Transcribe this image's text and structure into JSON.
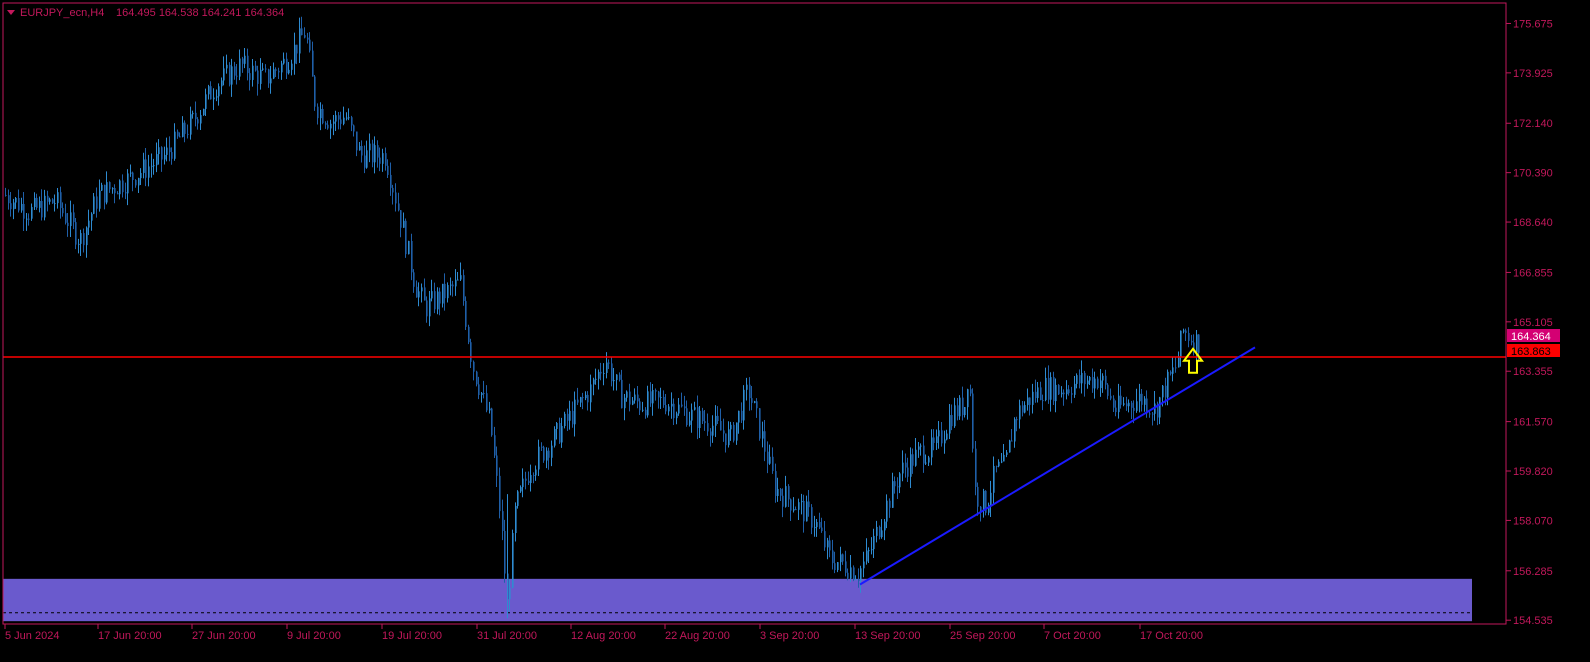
{
  "header": {
    "symbol": "EURJPY_ecn,H4",
    "ohlc": "164.495 164.538 164.241 164.364"
  },
  "colors": {
    "background": "#000000",
    "frame": "#c2185b",
    "text": "#c2185b",
    "candle": "#2e8bd1",
    "candle_dark": "#1f5fa8",
    "support_zone": "#6a5acd",
    "horizontal_line": "#ff0000",
    "trendline": "#1a1aff",
    "arrow": "#ffff00",
    "bid_tag": "#ff0000",
    "last_tag": "#d40073"
  },
  "chart_data": {
    "type": "candlestick",
    "title": "EURJPY_ecn,H4",
    "ylim": [
      154.4,
      176.4
    ],
    "y_ticks": [
      "175.675",
      "173.925",
      "172.140",
      "170.390",
      "168.640",
      "166.855",
      "165.105",
      "163.355",
      "161.570",
      "159.820",
      "158.070",
      "156.285",
      "154.535"
    ],
    "x_ticks": [
      "5 Jun 2024",
      "17 Jun 20:00",
      "27 Jun 20:00",
      "9 Jul 20:00",
      "19 Jul 20:00",
      "31 Jul 20:00",
      "12 Aug 20:00",
      "22 Aug 20:00",
      "3 Sep 20:00",
      "13 Sep 20:00",
      "25 Sep 20:00",
      "7 Oct 20:00",
      "17 Oct 20:00"
    ],
    "price_path_closes_by_tick": [
      {
        "x": "5 Jun 2024",
        "close": 169.8
      },
      {
        "x": "17 Jun 20:00",
        "close": 169.6
      },
      {
        "x": "27 Jun 20:00",
        "close": 173.8
      },
      {
        "x": "9 Jul 20:00",
        "close": 175.2
      },
      {
        "x": "19 Jul 20:00",
        "close": 170.0
      },
      {
        "x": "31 Jul 20:00",
        "close": 161.0
      },
      {
        "x": "12 Aug 20:00",
        "close": 162.5
      },
      {
        "x": "22 Aug 20:00",
        "close": 161.0
      },
      {
        "x": "3 Sep 20:00",
        "close": 158.5
      },
      {
        "x": "13 Sep 20:00",
        "close": 157.0
      },
      {
        "x": "25 Sep 20:00",
        "close": 160.5
      },
      {
        "x": "7 Oct 20:00",
        "close": 163.0
      },
      {
        "x": "17 Oct 20:00",
        "close": 164.364
      }
    ],
    "last_price": "164.364",
    "bid_price": "163.863",
    "horizontal_line_price": 163.86,
    "support_zone": {
      "low": 154.5,
      "high": 156.0,
      "midline": 154.8
    },
    "trendline": {
      "from": {
        "x": "13 Sep 20:00",
        "price": 155.8
      },
      "to": {
        "x": "after 17 Oct 20:00",
        "price": 164.2
      }
    },
    "signal_arrow": {
      "direction": "up",
      "x": "17 Oct 20:00",
      "price": 163.3
    }
  }
}
